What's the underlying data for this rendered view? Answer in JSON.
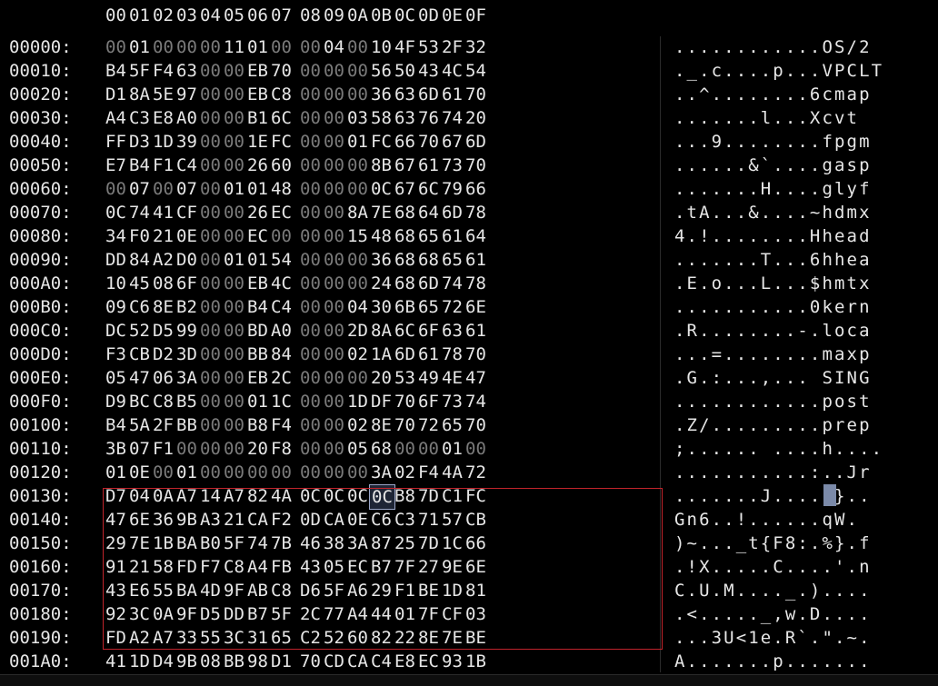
{
  "header_cols": [
    "00",
    "01",
    "02",
    "03",
    "04",
    "05",
    "06",
    "07",
    "08",
    "09",
    "0A",
    "0B",
    "0C",
    "0D",
    "0E",
    "0F"
  ],
  "rows": [
    {
      "addr": "00000:",
      "hex": [
        "00",
        "01",
        "00",
        "00",
        "00",
        "11",
        "01",
        "00",
        "00",
        "04",
        "00",
        "10",
        "4F",
        "53",
        "2F",
        "32"
      ],
      "ascii": "............OS/2"
    },
    {
      "addr": "00010:",
      "hex": [
        "B4",
        "5F",
        "F4",
        "63",
        "00",
        "00",
        "EB",
        "70",
        "00",
        "00",
        "00",
        "56",
        "50",
        "43",
        "4C",
        "54"
      ],
      "ascii": "._.c....p...VPCLT"
    },
    {
      "addr": "00020:",
      "hex": [
        "D1",
        "8A",
        "5E",
        "97",
        "00",
        "00",
        "EB",
        "C8",
        "00",
        "00",
        "00",
        "36",
        "63",
        "6D",
        "61",
        "70"
      ],
      "ascii": "..^........6cmap"
    },
    {
      "addr": "00030:",
      "hex": [
        "A4",
        "C3",
        "E8",
        "A0",
        "00",
        "00",
        "B1",
        "6C",
        "00",
        "00",
        "03",
        "58",
        "63",
        "76",
        "74",
        "20"
      ],
      "ascii": ".......l...Xcvt "
    },
    {
      "addr": "00040:",
      "hex": [
        "FF",
        "D3",
        "1D",
        "39",
        "00",
        "00",
        "1E",
        "FC",
        "00",
        "00",
        "01",
        "FC",
        "66",
        "70",
        "67",
        "6D"
      ],
      "ascii": "...9........fpgm"
    },
    {
      "addr": "00050:",
      "hex": [
        "E7",
        "B4",
        "F1",
        "C4",
        "00",
        "00",
        "26",
        "60",
        "00",
        "00",
        "00",
        "8B",
        "67",
        "61",
        "73",
        "70"
      ],
      "ascii": "......&`....gasp"
    },
    {
      "addr": "00060:",
      "hex": [
        "00",
        "07",
        "00",
        "07",
        "00",
        "01",
        "01",
        "48",
        "00",
        "00",
        "00",
        "0C",
        "67",
        "6C",
        "79",
        "66"
      ],
      "ascii": ".......H....glyf"
    },
    {
      "addr": "00070:",
      "hex": [
        "0C",
        "74",
        "41",
        "CF",
        "00",
        "00",
        "26",
        "EC",
        "00",
        "00",
        "8A",
        "7E",
        "68",
        "64",
        "6D",
        "78"
      ],
      "ascii": ".tA...&....~hdmx"
    },
    {
      "addr": "00080:",
      "hex": [
        "34",
        "F0",
        "21",
        "0E",
        "00",
        "00",
        "EC",
        "00",
        "00",
        "00",
        "15",
        "48",
        "68",
        "65",
        "61",
        "64"
      ],
      "ascii": "4.!........Hhead"
    },
    {
      "addr": "00090:",
      "hex": [
        "DD",
        "84",
        "A2",
        "D0",
        "00",
        "01",
        "01",
        "54",
        "00",
        "00",
        "00",
        "36",
        "68",
        "68",
        "65",
        "61"
      ],
      "ascii": ".......T...6hhea"
    },
    {
      "addr": "000A0:",
      "hex": [
        "10",
        "45",
        "08",
        "6F",
        "00",
        "00",
        "EB",
        "4C",
        "00",
        "00",
        "00",
        "24",
        "68",
        "6D",
        "74",
        "78"
      ],
      "ascii": ".E.o...L...$hmtx"
    },
    {
      "addr": "000B0:",
      "hex": [
        "09",
        "C6",
        "8E",
        "B2",
        "00",
        "00",
        "B4",
        "C4",
        "00",
        "00",
        "04",
        "30",
        "6B",
        "65",
        "72",
        "6E"
      ],
      "ascii": "...........0kern"
    },
    {
      "addr": "000C0:",
      "hex": [
        "DC",
        "52",
        "D5",
        "99",
        "00",
        "00",
        "BD",
        "A0",
        "00",
        "00",
        "2D",
        "8A",
        "6C",
        "6F",
        "63",
        "61"
      ],
      "ascii": ".R........-.loca"
    },
    {
      "addr": "000D0:",
      "hex": [
        "F3",
        "CB",
        "D2",
        "3D",
        "00",
        "00",
        "BB",
        "84",
        "00",
        "00",
        "02",
        "1A",
        "6D",
        "61",
        "78",
        "70"
      ],
      "ascii": "...=........maxp"
    },
    {
      "addr": "000E0:",
      "hex": [
        "05",
        "47",
        "06",
        "3A",
        "00",
        "00",
        "EB",
        "2C",
        "00",
        "00",
        "00",
        "20",
        "53",
        "49",
        "4E",
        "47"
      ],
      "ascii": ".G.:...,... SING"
    },
    {
      "addr": "000F0:",
      "hex": [
        "D9",
        "BC",
        "C8",
        "B5",
        "00",
        "00",
        "01",
        "1C",
        "00",
        "00",
        "1D",
        "DF",
        "70",
        "6F",
        "73",
        "74"
      ],
      "ascii": "............post"
    },
    {
      "addr": "00100:",
      "hex": [
        "B4",
        "5A",
        "2F",
        "BB",
        "00",
        "00",
        "B8",
        "F4",
        "00",
        "00",
        "02",
        "8E",
        "70",
        "72",
        "65",
        "70"
      ],
      "ascii": ".Z/.........prep"
    },
    {
      "addr": "00110:",
      "hex": [
        "3B",
        "07",
        "F1",
        "00",
        "00",
        "00",
        "20",
        "F8",
        "00",
        "00",
        "05",
        "68",
        "00",
        "00",
        "01",
        "00"
      ],
      "ascii": ";...... ....h...."
    },
    {
      "addr": "00120:",
      "hex": [
        "01",
        "0E",
        "00",
        "01",
        "00",
        "00",
        "00",
        "00",
        "00",
        "00",
        "00",
        "3A",
        "02",
        "F4",
        "4A",
        "72"
      ],
      "ascii": "...........:..Jr"
    },
    {
      "addr": "00130:",
      "hex": [
        "D7",
        "04",
        "0A",
        "A7",
        "14",
        "A7",
        "82",
        "4A",
        "0C",
        "0C",
        "0C",
        "0C",
        "B8",
        "7D",
        "C1",
        "FC"
      ],
      "ascii": ".......J.....}.."
    },
    {
      "addr": "00140:",
      "hex": [
        "47",
        "6E",
        "36",
        "9B",
        "A3",
        "21",
        "CA",
        "F2",
        "0D",
        "CA",
        "0E",
        "C6",
        "C3",
        "71",
        "57",
        "CB"
      ],
      "ascii": "Gn6..!......qW."
    },
    {
      "addr": "00150:",
      "hex": [
        "29",
        "7E",
        "1B",
        "BA",
        "B0",
        "5F",
        "74",
        "7B",
        "46",
        "38",
        "3A",
        "87",
        "25",
        "7D",
        "1C",
        "66"
      ],
      "ascii": ")~..._t{F8:.%}.f"
    },
    {
      "addr": "00160:",
      "hex": [
        "91",
        "21",
        "58",
        "FD",
        "F7",
        "C8",
        "A4",
        "FB",
        "43",
        "05",
        "EC",
        "B7",
        "7F",
        "27",
        "9E",
        "6E"
      ],
      "ascii": ".!X.....C....'.n"
    },
    {
      "addr": "00170:",
      "hex": [
        "43",
        "E6",
        "55",
        "BA",
        "4D",
        "9F",
        "AB",
        "C8",
        "D6",
        "5F",
        "A6",
        "29",
        "F1",
        "BE",
        "1D",
        "81"
      ],
      "ascii": "C.U.M...._.)...."
    },
    {
      "addr": "00180:",
      "hex": [
        "92",
        "3C",
        "0A",
        "9F",
        "D5",
        "DD",
        "B7",
        "5F",
        "2C",
        "77",
        "A4",
        "44",
        "01",
        "7F",
        "CF",
        "03"
      ],
      "ascii": ".<....._,w.D...."
    },
    {
      "addr": "00190:",
      "hex": [
        "FD",
        "A2",
        "A7",
        "33",
        "55",
        "3C",
        "31",
        "65",
        "C2",
        "52",
        "60",
        "82",
        "22",
        "8E",
        "7E",
        "BE"
      ],
      "ascii": "...3U<1e.R`.\".~."
    },
    {
      "addr": "001A0:",
      "hex": [
        "41",
        "1D",
        "D4",
        "9B",
        "08",
        "BB",
        "98",
        "D1",
        "70",
        "CD",
        "CA",
        "C4",
        "E8",
        "EC",
        "93",
        "1B"
      ],
      "ascii": "A.......p......."
    }
  ],
  "cursor": {
    "row": 19,
    "col": 11,
    "ascii_col": 11
  },
  "selection": {
    "start_address": "00130",
    "end_address": "0019F"
  },
  "colors": {
    "background": "#000000",
    "text": "#e6e6e6",
    "zero_byte": "#7a7a7a",
    "selection_border": "#c0232b",
    "cursor": "#9aa6c8"
  }
}
